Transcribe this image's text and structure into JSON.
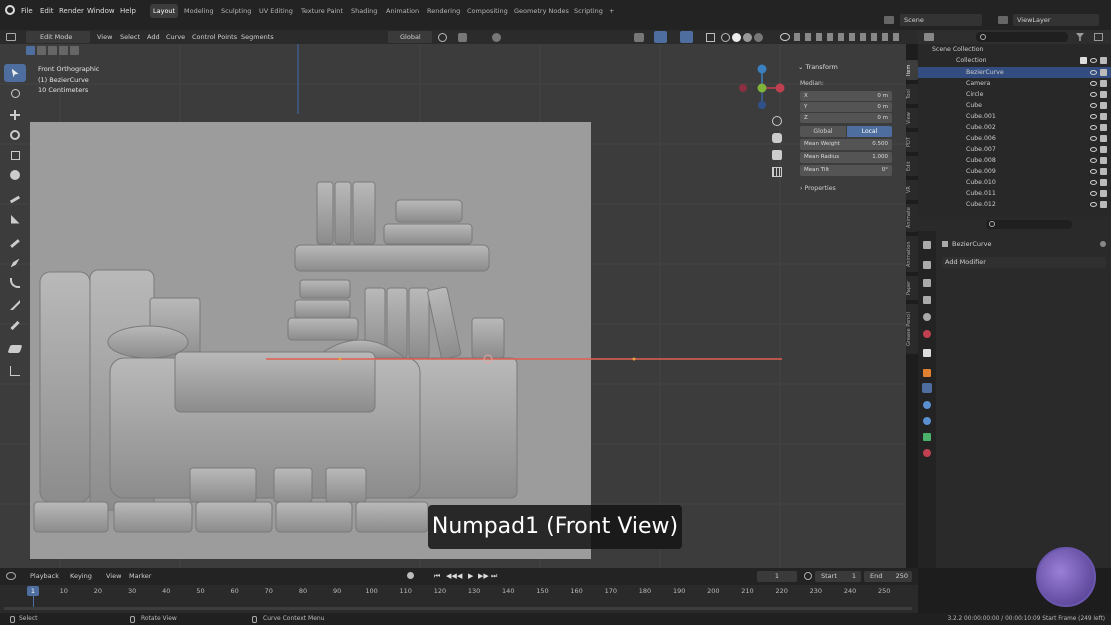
{
  "topbar": {
    "menus": [
      "File",
      "Edit",
      "Render",
      "Window",
      "Help"
    ],
    "workspaces": [
      "Layout",
      "Modeling",
      "Sculpting",
      "UV Editing",
      "Texture Paint",
      "Shading",
      "Animation",
      "Rendering",
      "Compositing",
      "Geometry Nodes",
      "Scripting",
      "+"
    ],
    "active_workspace": "Layout",
    "scene": "Scene",
    "view_layer": "ViewLayer"
  },
  "viewport_header": {
    "mode": "Edit Mode",
    "menus": [
      "View",
      "Select",
      "Add",
      "Curve",
      "Control Points",
      "Segments"
    ],
    "orientation": "Global"
  },
  "viewport_info": {
    "line1": "Front Orthographic",
    "line2": "(1) BezierCurve",
    "line3": "10 Centimeters"
  },
  "npanel": {
    "section": "Transform",
    "median_label": "Median:",
    "fields": [
      {
        "label": "X",
        "value": "0 m"
      },
      {
        "label": "Y",
        "value": "0 m"
      },
      {
        "label": "Z",
        "value": "0 m"
      }
    ],
    "global": "Global",
    "local": "Local",
    "mean_weight_label": "Mean Weight",
    "mean_weight": "0.500",
    "mean_radius_label": "Mean Radius",
    "mean_radius": "1.000",
    "mean_tilt_label": "Mean Tilt",
    "mean_tilt": "0°",
    "properties": "Properties"
  },
  "side_tabs": [
    "Item",
    "Tool",
    "View",
    "PDT",
    "Edit",
    "VR",
    "Animate",
    "Animation",
    "Paper",
    "Grease Pencil"
  ],
  "outliner": {
    "root": "Scene Collection",
    "collection": "Collection",
    "items": [
      "BezierCurve",
      "Camera",
      "Circle",
      "Cube",
      "Cube.001",
      "Cube.002",
      "Cube.006",
      "Cube.007",
      "Cube.008",
      "Cube.009",
      "Cube.010",
      "Cube.011",
      "Cube.012"
    ]
  },
  "properties": {
    "object": "BezierCurve",
    "add_modifier": "Add Modifier"
  },
  "timeline": {
    "menus": [
      "Playback",
      "Keying",
      "View",
      "Marker"
    ],
    "current_frame": "1",
    "start_label": "Start",
    "start": "1",
    "end_label": "End",
    "end": "250",
    "ticks": [
      "1",
      "10",
      "20",
      "30",
      "40",
      "50",
      "60",
      "70",
      "80",
      "90",
      "100",
      "110",
      "120",
      "130",
      "140",
      "150",
      "160",
      "170",
      "180",
      "190",
      "200",
      "210",
      "220",
      "230",
      "240",
      "250"
    ]
  },
  "status": {
    "select": "Select",
    "rotate": "Rotate View",
    "context": "Curve Context Menu",
    "right": "3.2.2 00:00:00:00 / 00:00:10:09 Start Frame (249 left)"
  },
  "overlay_text": "Numpad1 (Front View)",
  "colors": {
    "accent": "#4d6e9e",
    "selected_row": "#334d80",
    "curve": "#e06050"
  }
}
